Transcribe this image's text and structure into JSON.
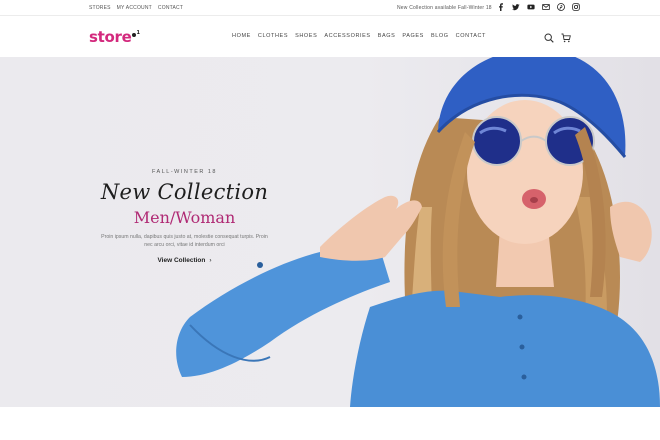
{
  "topbar": {
    "links": [
      "Stores",
      "My Account",
      "Contact"
    ],
    "promo": "New Collection available Fall-Winter 18",
    "socials": [
      "facebook-icon",
      "twitter-icon",
      "youtube-icon",
      "email-icon",
      "pinterest-icon",
      "instagram-icon"
    ]
  },
  "header": {
    "logo": "store",
    "logo_sup": "1",
    "nav": [
      "Home",
      "Clothes",
      "Shoes",
      "Accessories",
      "Bags",
      "Pages",
      "Blog",
      "Contact"
    ],
    "icons": [
      "search-icon",
      "cart-icon"
    ]
  },
  "hero": {
    "season": "Fall-Winter 18",
    "headline": "New Collection",
    "subheadline": "Men/Woman",
    "description": "Proin ipsum nulla, dapibus quis justo at, molestie consequat turpis. Proin nec arcu orci, vitae id interdum orci",
    "cta": "View Collection",
    "cta_chevron": "›"
  },
  "colors": {
    "brand": "#d3297d",
    "accent_text": "#b02a74",
    "hat": "#2f5fc4",
    "shirt": "#4a8fd6"
  }
}
